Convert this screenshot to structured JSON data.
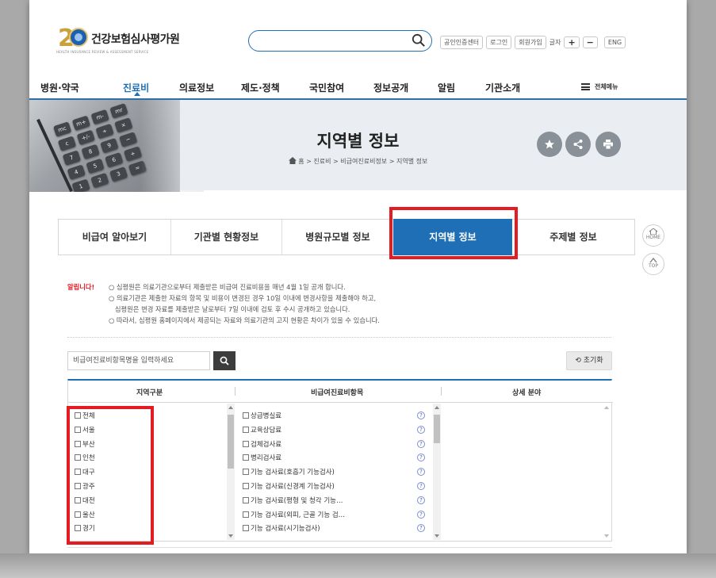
{
  "header": {
    "logo_title": "건강보험심사평가원",
    "logo_sub": "HEALTH INSURANCE REVIEW & ASSESSMENT SERVICE",
    "utils": [
      "공인인증센터",
      "로그인",
      "회원가입"
    ],
    "font_label": "글자",
    "font_plus": "+",
    "font_minus": "−",
    "lang": "ENG"
  },
  "gnb": {
    "items": [
      "병원·약국",
      "진료비",
      "의료정보",
      "제도·정책",
      "국민참여",
      "정보공개",
      "알림",
      "기관소개"
    ],
    "active_index": 1,
    "all_menu": "전체메뉴"
  },
  "banner": {
    "title": "지역별 정보",
    "breadcrumb": [
      "홈",
      "진료비",
      "비급여진료비정보",
      "지역별 정보"
    ],
    "calc_keys": [
      "mc",
      "m+",
      "m-",
      "mr",
      "c",
      "+/-",
      "÷",
      "×",
      "7",
      "8",
      "9",
      "−",
      "4",
      "5",
      "6",
      "+",
      "1",
      "2",
      "3",
      "="
    ]
  },
  "tabs": {
    "items": [
      "비급여 알아보기",
      "기관별 현황정보",
      "병원규모별 정보",
      "지역별 정보",
      "주제별 정보"
    ],
    "active_index": 3
  },
  "side": {
    "home": "HOME",
    "top": "TOP"
  },
  "notice": {
    "label": "알립니다!",
    "lines": [
      "○ 심평원은 의료기관으로부터 제출받은 비급여 진료비용을 매년 4월 1일 공개 합니다.",
      "○ 의료기관은 제출한 자료의 항목 및 비용이 변경된 경우 10일 이내에 변경사항을 제출해야 하고,",
      "   심평원은 변경 자료를 제출받은 날로부터 7일 이내에 검토 후 수시 공개하고 있습니다.",
      "○ 따라서, 심평원 홈페이지에서 제공되는 자료와 의료기관의 고지 현황은 차이가 있을 수 있습니다."
    ]
  },
  "filter": {
    "placeholder": "비급여진료비항목명을 입력하세요",
    "reset": "초기화"
  },
  "table": {
    "headers": [
      "지역구분",
      "비급여진료비항목",
      "상세 분야"
    ],
    "regions": [
      "전체",
      "서울",
      "부산",
      "인천",
      "대구",
      "광주",
      "대전",
      "울산",
      "경기"
    ],
    "items": [
      "상급병실료",
      "교육상담료",
      "검체검사료",
      "병리검사료",
      "기능 검사료(호흡기 기능검사)",
      "기능 검사료(신경계 기능검사)",
      "기능 검사료(평형 및 청각 기능…",
      "기능 검사료(외피, 근골 기능 검…",
      "기능 검사료(시기능검사)"
    ],
    "help_glyph": "?"
  },
  "colors": {
    "accent": "#1f6fb6",
    "highlight": "#e41b23"
  }
}
